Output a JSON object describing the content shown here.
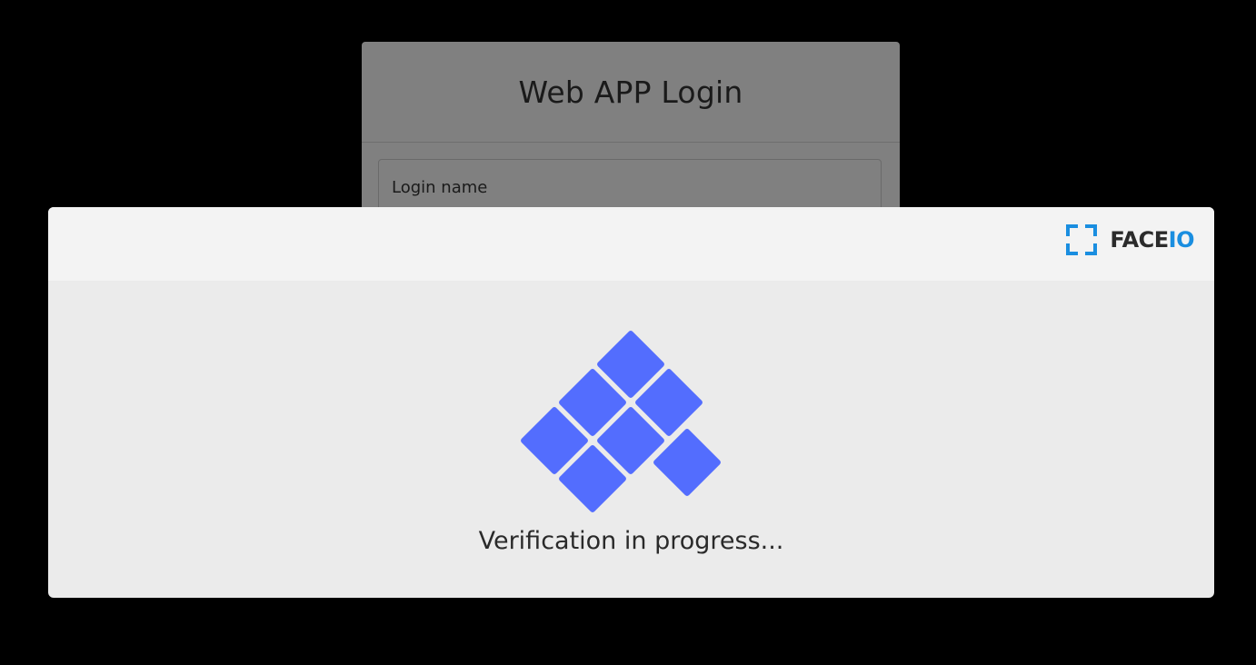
{
  "login": {
    "title": "Web APP Login",
    "login_name_placeholder": "Login name"
  },
  "modal": {
    "brand": {
      "face": "FACE",
      "io": "IO",
      "accent_color": "#1a8ee0"
    },
    "spinner_icon": "tile-loader-icon",
    "spinner_color": "#536dfe",
    "status_text": "Verification in progress..."
  }
}
